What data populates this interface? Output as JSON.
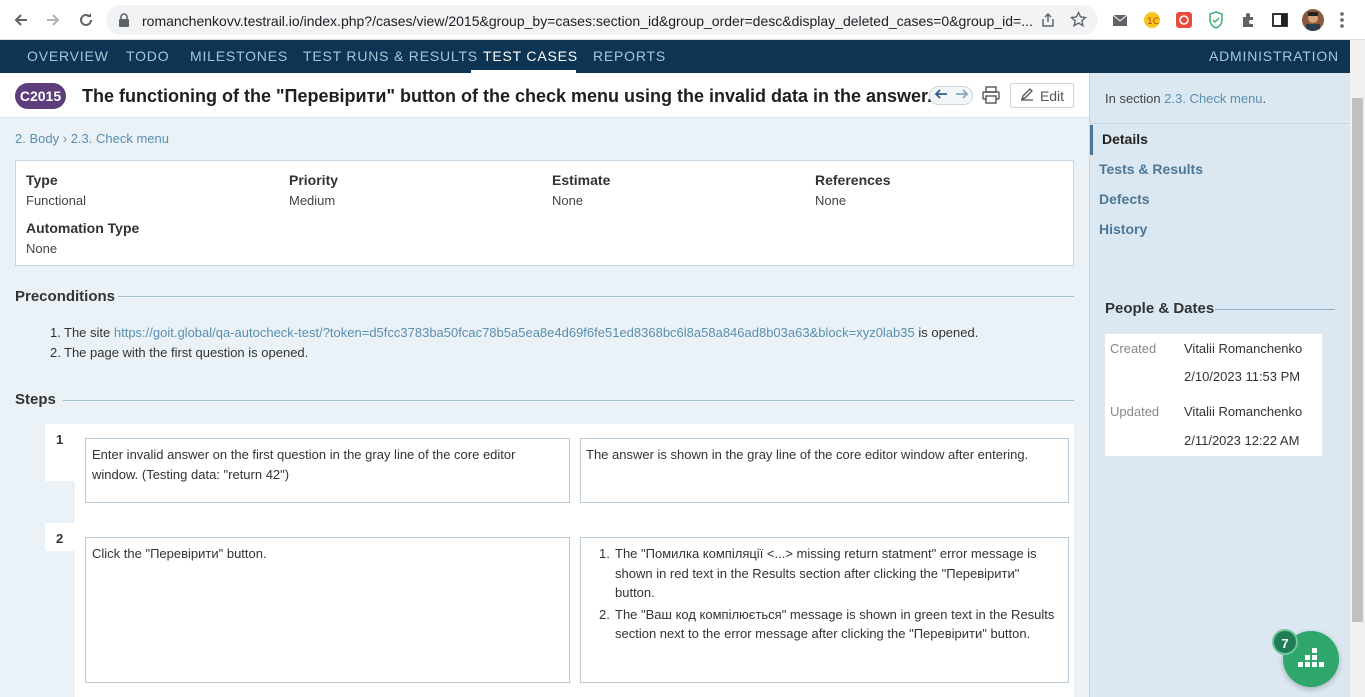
{
  "browser": {
    "url": "romanchenkovv.testrail.io/index.php?/cases/view/2015&group_by=cases:section_id&group_order=desc&display_deleted_cases=0&group_id=..."
  },
  "nav": {
    "items": [
      "OVERVIEW",
      "TODO",
      "MILESTONES",
      "TEST RUNS & RESULTS",
      "TEST CASES",
      "REPORTS"
    ],
    "active": "TEST CASES",
    "admin": "ADMINISTRATION"
  },
  "case": {
    "id": "C2015",
    "title": "The functioning of the \"Перевірити\" button of the check menu using the invalid data in the answer.",
    "edit_label": "Edit"
  },
  "breadcrumb": {
    "part1": "2. Body",
    "sep": "›",
    "part2": "2.3. Check menu"
  },
  "fields": {
    "type_label": "Type",
    "type_value": "Functional",
    "priority_label": "Priority",
    "priority_value": "Medium",
    "estimate_label": "Estimate",
    "estimate_value": "None",
    "references_label": "References",
    "references_value": "None",
    "automation_label": "Automation Type",
    "automation_value": "None"
  },
  "preconditions": {
    "heading": "Preconditions",
    "item1_num": "1.",
    "item1_pre": "The site ",
    "item1_link": "https://goit.global/qa-autocheck-test/?token=d5fcc3783ba50fcac78b5a5ea8e4d69f6fe51ed8368bc6l8a58a846ad8b03a63&block=xyz0lab35",
    "item1_post": " is opened.",
    "item2_num": "2.",
    "item2": "The page with the first question is opened."
  },
  "steps": {
    "heading": "Steps",
    "step1_num": "1",
    "step1_action": "Enter invalid answer on the first question in the gray line of the core editor window. (Testing data: \"return 42\")",
    "step1_expected": "The answer is shown in the gray line of the core editor window after entering.",
    "step2_num": "2",
    "step2_action": "Click the \"Перевірити\" button.",
    "step2_exp1_num": "1.",
    "step2_exp1": "The \"Помилка компіляції <...> missing return statment\" error message is shown in red text in the Results section after clicking the \"Перевірити\" button.",
    "step2_exp2_num": "2.",
    "step2_exp2": "The \"Ваш код компілюється\" message is shown in green text in the Results section next to the error message after clicking the \"Перевірити\" button."
  },
  "sidebar": {
    "in_section_prefix": "In section ",
    "in_section_link": "2.3. Check menu",
    "in_section_suffix": ".",
    "tabs": [
      "Details",
      "Tests & Results",
      "Defects",
      "History"
    ],
    "people_dates_heading": "People & Dates",
    "created_label": "Created",
    "created_by": "Vitalii Romanchenko",
    "created_at": "2/10/2023 11:53 PM",
    "updated_label": "Updated",
    "updated_by": "Vitalii Romanchenko",
    "updated_at": "2/11/2023 12:22 AM"
  },
  "chat": {
    "badge": "7"
  },
  "colors": {
    "nav_bg": "#0d3553",
    "badge_bg": "#5d3d7c",
    "link": "#5a8fb0",
    "chat": "#2fa66b"
  }
}
